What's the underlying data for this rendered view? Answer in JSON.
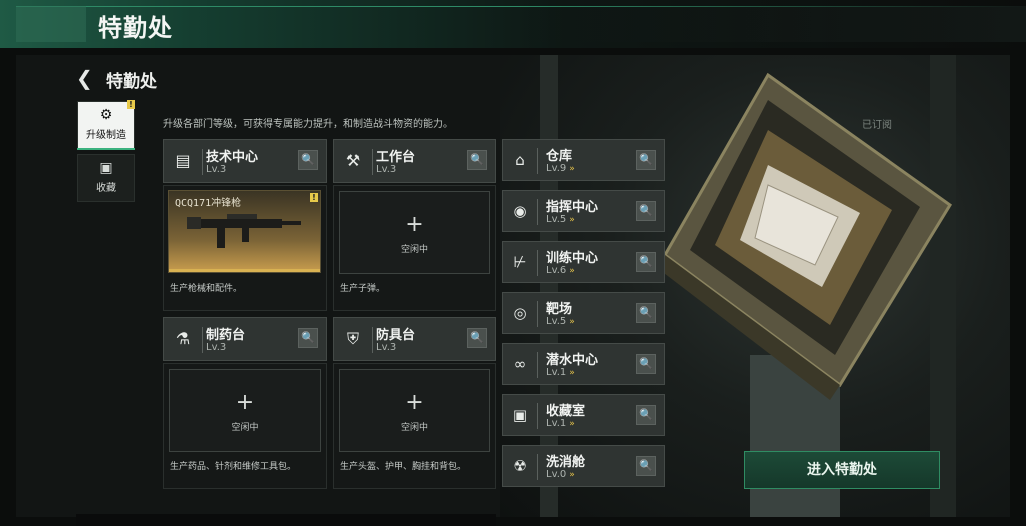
{
  "top_banner": {
    "title": "特勤处"
  },
  "header": {
    "back_icon": "back-arrow-icon",
    "title": "特勤处"
  },
  "description": "升级各部门等级，可获得专属能力提升，和制造战斗物资的能力。",
  "tabs": [
    {
      "label": "升级制造",
      "icon": "upgrade-icon",
      "active": true,
      "badge": "!"
    },
    {
      "label": "收藏",
      "icon": "collection-icon",
      "active": false
    }
  ],
  "stations": [
    {
      "name": "技术中心",
      "level": "Lv.3",
      "icon": "tech-center-icon",
      "slot_item": "QCQ171冲锋枪",
      "slot_badge": "!",
      "desc": "生产枪械和配件。"
    },
    {
      "name": "工作台",
      "level": "Lv.3",
      "icon": "workbench-icon",
      "slot_plus": "+",
      "slot_status": "空闲中",
      "desc": "生产子弹。"
    },
    {
      "name": "制药台",
      "level": "Lv.3",
      "icon": "pharmacy-icon",
      "slot_plus": "+",
      "slot_status": "空闲中",
      "desc": "生产药品、针剂和维修工具包。"
    },
    {
      "name": "防具台",
      "level": "Lv.3",
      "icon": "armor-bench-icon",
      "slot_plus": "+",
      "slot_status": "空闲中",
      "desc": "生产头盔、护甲、胸挂和背包。"
    }
  ],
  "departments": [
    {
      "name": "仓库",
      "level": "Lv.9",
      "icon": "warehouse-icon"
    },
    {
      "name": "指挥中心",
      "level": "Lv.5",
      "icon": "command-center-icon"
    },
    {
      "name": "训练中心",
      "level": "Lv.6",
      "icon": "training-center-icon"
    },
    {
      "name": "靶场",
      "level": "Lv.5",
      "icon": "shooting-range-icon"
    },
    {
      "name": "潜水中心",
      "level": "Lv.1",
      "icon": "diving-center-icon"
    },
    {
      "name": "收藏室",
      "level": "Lv.1",
      "icon": "collection-room-icon"
    },
    {
      "name": "洗消舱",
      "level": "Lv.0",
      "icon": "decon-chamber-icon"
    }
  ],
  "upgrade_indicator": "»",
  "search_glyph": "🔍",
  "subscribed_label": "已订阅",
  "enter_button": "进入特勤处",
  "colors": {
    "accent_green": "#2f8c63",
    "upgrade_gold": "#e3c14a",
    "badge_yellow": "#e7c94a"
  }
}
